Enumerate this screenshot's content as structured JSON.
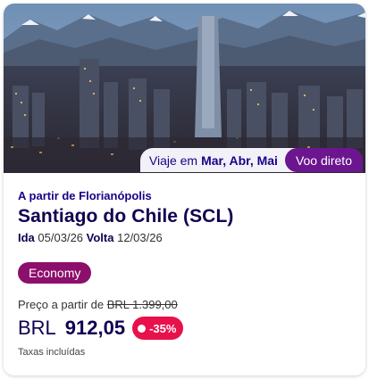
{
  "card": {
    "image_alt": "Santiago skyline with Andes mountains",
    "months_prefix": "Viaje em",
    "months": "Mar, Abr, Mai",
    "direct_label": "Voo direto",
    "origin": "A partir de Florianópolis",
    "destination": "Santiago do Chile (SCL)",
    "outbound_label": "Ida",
    "outbound_date": "05/03/26",
    "return_label": "Volta",
    "return_date": "12/03/26",
    "cabin": "Economy",
    "from_price_label": "Preço a partir de",
    "old_price": "BRL 1.399,00",
    "currency": "BRL",
    "price": "912,05",
    "discount": "-35%",
    "taxes_note": "Taxas incluídas"
  },
  "colors": {
    "brand_navy": "#10004f",
    "brand_blue": "#1b0088",
    "purple_tag": "#6b168f",
    "cabin_tag": "#8c0f6c",
    "discount": "#e8114b"
  },
  "icons": [
    "discount-dot-icon"
  ]
}
